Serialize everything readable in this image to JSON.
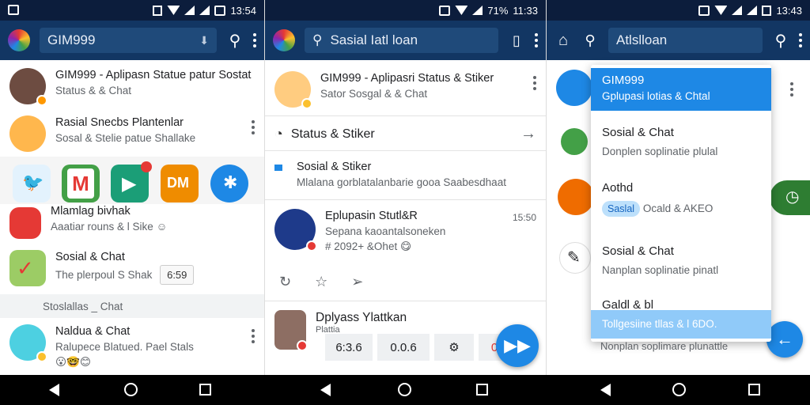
{
  "status": {
    "time1": "13:54",
    "time2": "11:33",
    "time3": "13:43",
    "battery2": "71%"
  },
  "p1": {
    "search_text": "GIM999",
    "rows": [
      {
        "title": "GIM999 - Aplipasn Statue patur Sostat",
        "sub": "Status & & Chat"
      },
      {
        "title": "Rasial Snecbs Plantenlar",
        "sub": "Sosal & Stelie patue Shallake"
      },
      {
        "title": "Mlamlag bivhak",
        "sub": "Aaatiar rouns & l Sike ☺"
      },
      {
        "title": "Sosial & Chat",
        "sub": "The plerpoul S Shak",
        "chip": "6:59"
      }
    ],
    "section_label": "Stoslallas _ Chat",
    "last_row": {
      "title": "Naldua & Chat",
      "sub": "Ralupece Blatued. Pael Stals",
      "emoji": "😮🤓😊"
    },
    "tiles_colors": [
      "#1e88e5",
      "#43a047",
      "#ef6c00",
      "#1565c0",
      "#e53935"
    ]
  },
  "p2": {
    "search_text": "Sasial Iatl loan",
    "row1": {
      "title": "GIM999 - Aplipasri Status & Stiker",
      "sub": "Sator Sosgal & & Chat"
    },
    "row2": {
      "title": "Status & Stiker"
    },
    "row3": {
      "title": "Sosial & Stiker",
      "sub": "Mlalana gorblatalanbarie gooa Saabesdhaat"
    },
    "row4": {
      "title": "Eplupasin Stutl&R",
      "sub": "Sepana kaoantalsoneken",
      "meta": "# 2092+ &Ohet 😋",
      "time": "15:50"
    },
    "row5": {
      "title": "Dplyass Ylattkan",
      "sub": "Plattia"
    },
    "buttons": [
      "6:3.6",
      "0.0.6",
      "0"
    ]
  },
  "p3": {
    "search_text": "Atlslloan",
    "dropdown": [
      {
        "title": "GIM999",
        "sub": "Gplupasi lotias & Chtal"
      },
      {
        "title": "Sosial & Chat",
        "sub": "Donplen soplinatie plulal"
      },
      {
        "title": "Aothd",
        "pill": "Saslal",
        "sub": "Ocald & AKEO"
      },
      {
        "title": "Sosial & Chat",
        "sub": "Nanplan soplinatie pinatl"
      },
      {
        "title": "Galdl & bl",
        "sub": "Tollgesiine tllas & l 6DO."
      }
    ],
    "under_text": "Nonplan soplimare plunattle"
  }
}
